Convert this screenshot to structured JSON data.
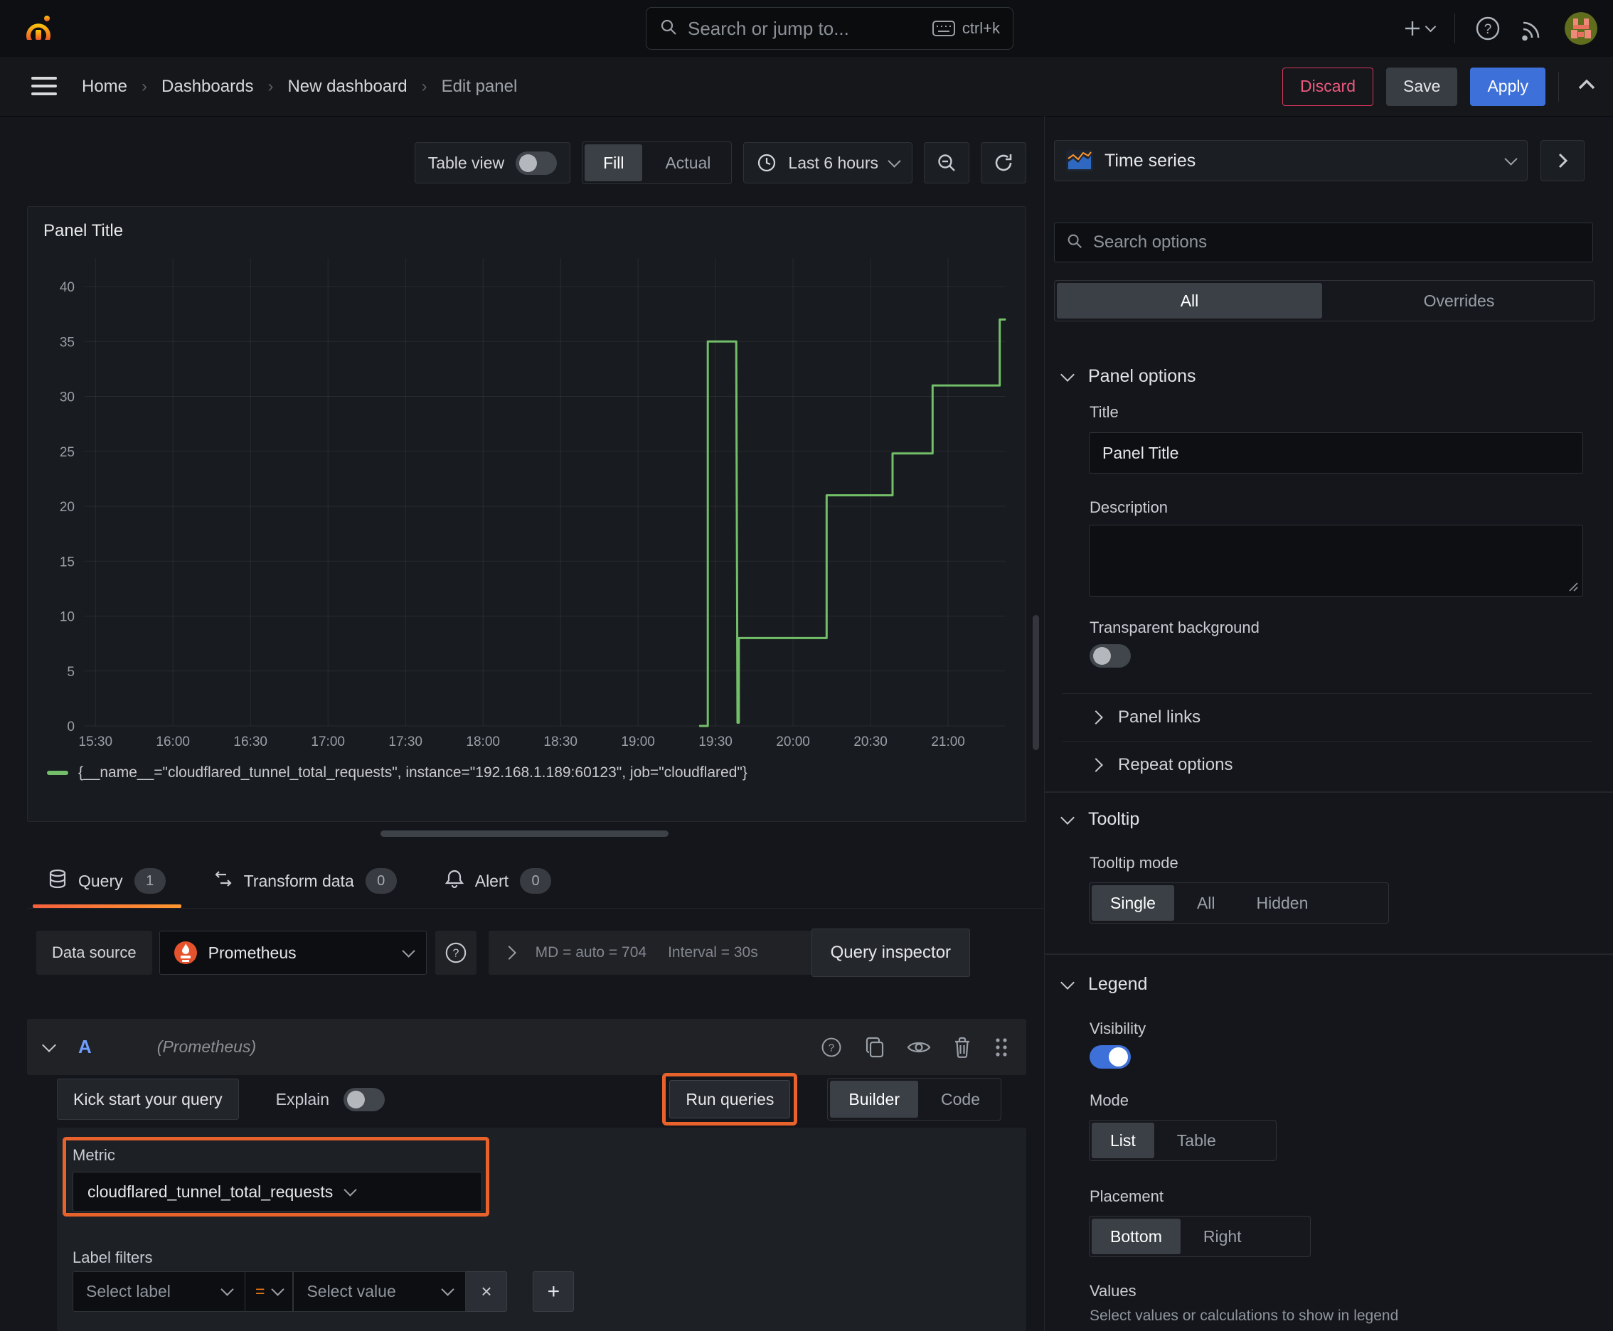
{
  "topbar": {
    "search_placeholder": "Search or jump to...",
    "shortcut": "ctrl+k"
  },
  "breadcrumb": {
    "items": [
      "Home",
      "Dashboards",
      "New dashboard",
      "Edit panel"
    ]
  },
  "actions": {
    "discard": "Discard",
    "save": "Save",
    "apply": "Apply"
  },
  "panel_toolbar": {
    "table_view": "Table view",
    "fill": "Fill",
    "actual": "Actual",
    "time_range": "Last 6 hours"
  },
  "panel": {
    "title": "Panel Title"
  },
  "chart_data": {
    "type": "line",
    "step": true,
    "title": "Panel Title",
    "xlabel": "",
    "ylabel": "",
    "grid": true,
    "legend_position": "bottom",
    "x_ticks": [
      "15:30",
      "16:00",
      "16:30",
      "17:00",
      "17:30",
      "18:00",
      "18:30",
      "19:00",
      "19:30",
      "20:00",
      "20:30",
      "21:00"
    ],
    "x_tick_minutes": [
      0,
      30,
      60,
      90,
      120,
      150,
      180,
      210,
      240,
      270,
      300,
      330
    ],
    "x_domain_minutes": [
      -4.2,
      352
    ],
    "y_ticks": [
      0,
      5,
      10,
      15,
      20,
      25,
      30,
      35,
      40
    ],
    "y_domain": [
      0,
      43
    ],
    "series": [
      {
        "name": "{__name__=\"cloudflared_tunnel_total_requests\", instance=\"192.168.1.189:60123\", job=\"cloudflared\"}",
        "color": "#73bf69",
        "points_minutes_value": [
          [
            234,
            0
          ],
          [
            237,
            0
          ],
          [
            237,
            35
          ],
          [
            248,
            35
          ],
          [
            248.5,
            0.3
          ],
          [
            249,
            0.3
          ],
          [
            249,
            8
          ],
          [
            283,
            8
          ],
          [
            283,
            21
          ],
          [
            308.5,
            21
          ],
          [
            308.5,
            24.8
          ],
          [
            324,
            24.8
          ],
          [
            324,
            31
          ],
          [
            350,
            31
          ],
          [
            350,
            37
          ],
          [
            352,
            37
          ]
        ]
      }
    ]
  },
  "tabs": {
    "query": "Query",
    "query_count": "1",
    "transform": "Transform data",
    "transform_count": "0",
    "alert": "Alert",
    "alert_count": "0"
  },
  "datasource_row": {
    "label": "Data source",
    "value": "Prometheus",
    "expand_stats": "MD = auto = 704",
    "interval": "Interval = 30s",
    "inspector": "Query inspector"
  },
  "query_row": {
    "letter": "A",
    "datasource": "(Prometheus)"
  },
  "query_actions": {
    "kick_start": "Kick start your query",
    "explain": "Explain",
    "run": "Run queries",
    "builder": "Builder",
    "code": "Code"
  },
  "metric": {
    "label": "Metric",
    "value": "cloudflared_tunnel_total_requests"
  },
  "label_filters": {
    "label": "Label filters",
    "select_label": "Select label",
    "operator": "=",
    "select_value": "Select value",
    "remove": "×",
    "add": "+"
  },
  "sidebar": {
    "viz": "Time series",
    "search_placeholder": "Search options",
    "tabs": {
      "all": "All",
      "overrides": "Overrides"
    },
    "panel_options": {
      "title": "Panel options",
      "title_label": "Title",
      "title_value": "Panel Title",
      "description_label": "Description",
      "transparent_label": "Transparent background"
    },
    "panel_links": "Panel links",
    "repeat_options": "Repeat options",
    "tooltip": {
      "title": "Tooltip",
      "mode_label": "Tooltip mode",
      "modes": [
        "Single",
        "All",
        "Hidden"
      ],
      "active": "Single"
    },
    "legend": {
      "title": "Legend",
      "visibility_label": "Visibility",
      "mode_label": "Mode",
      "modes": [
        "List",
        "Table"
      ],
      "active_mode": "List",
      "placement_label": "Placement",
      "placements": [
        "Bottom",
        "Right"
      ],
      "active_placement": "Bottom",
      "values_label": "Values",
      "values_hint": "Select values or calculations to show in legend"
    }
  },
  "colors": {
    "accent_orange": "#e8622c",
    "tab_underline_start": "#f55f3e",
    "tab_underline_end": "#ff9830",
    "apply_blue": "#3d71d9",
    "discard_red": "#d3365c",
    "series_green": "#73bf69",
    "operator_orange": "#eb7b18"
  }
}
